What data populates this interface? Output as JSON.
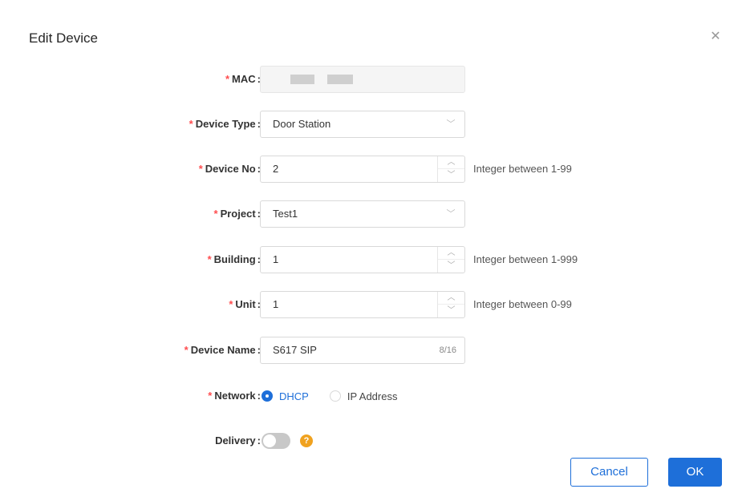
{
  "dialog": {
    "title": "Edit Device",
    "close_icon": "close-icon"
  },
  "fields": {
    "mac": {
      "label": "MAC",
      "required": "*",
      "value": ""
    },
    "device_type": {
      "label": "Device Type",
      "required": "*",
      "value": "Door Station"
    },
    "device_no": {
      "label": "Device No",
      "required": "*",
      "value": "2",
      "hint": "Integer between 1-99"
    },
    "project": {
      "label": "Project",
      "required": "*",
      "value": "Test1"
    },
    "building": {
      "label": "Building",
      "required": "*",
      "value": "1",
      "hint": "Integer between 1-999"
    },
    "unit": {
      "label": "Unit",
      "required": "*",
      "value": "1",
      "hint": "Integer between 0-99"
    },
    "device_name": {
      "label": "Device Name",
      "required": "*",
      "value": "S617 SIP",
      "counter": "8/16"
    },
    "network": {
      "label": "Network",
      "required": "*",
      "options": [
        "DHCP",
        "IP Address"
      ],
      "selected": "DHCP"
    },
    "delivery": {
      "label": "Delivery",
      "enabled": false,
      "help_icon": "question-icon"
    }
  },
  "colon": ":",
  "footer": {
    "cancel_label": "Cancel",
    "ok_label": "OK"
  },
  "colors": {
    "accent": "#1e6fd9",
    "required": "#ff4d4f",
    "help": "#f0a21f"
  }
}
